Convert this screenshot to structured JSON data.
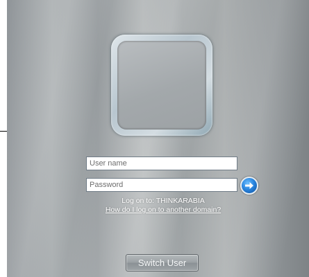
{
  "username_field": {
    "placeholder": "User name",
    "value": ""
  },
  "password_field": {
    "placeholder": "Password",
    "value": ""
  },
  "logon_to": "Log on to: THINKARABIA",
  "domain_help_link": "How do I log on to another domain?",
  "switch_user_label": "Switch User",
  "icons": {
    "submit": "arrow-right-circle-icon"
  },
  "colors": {
    "arrow_button": "#2a86e0",
    "background": "#a5aaac"
  }
}
